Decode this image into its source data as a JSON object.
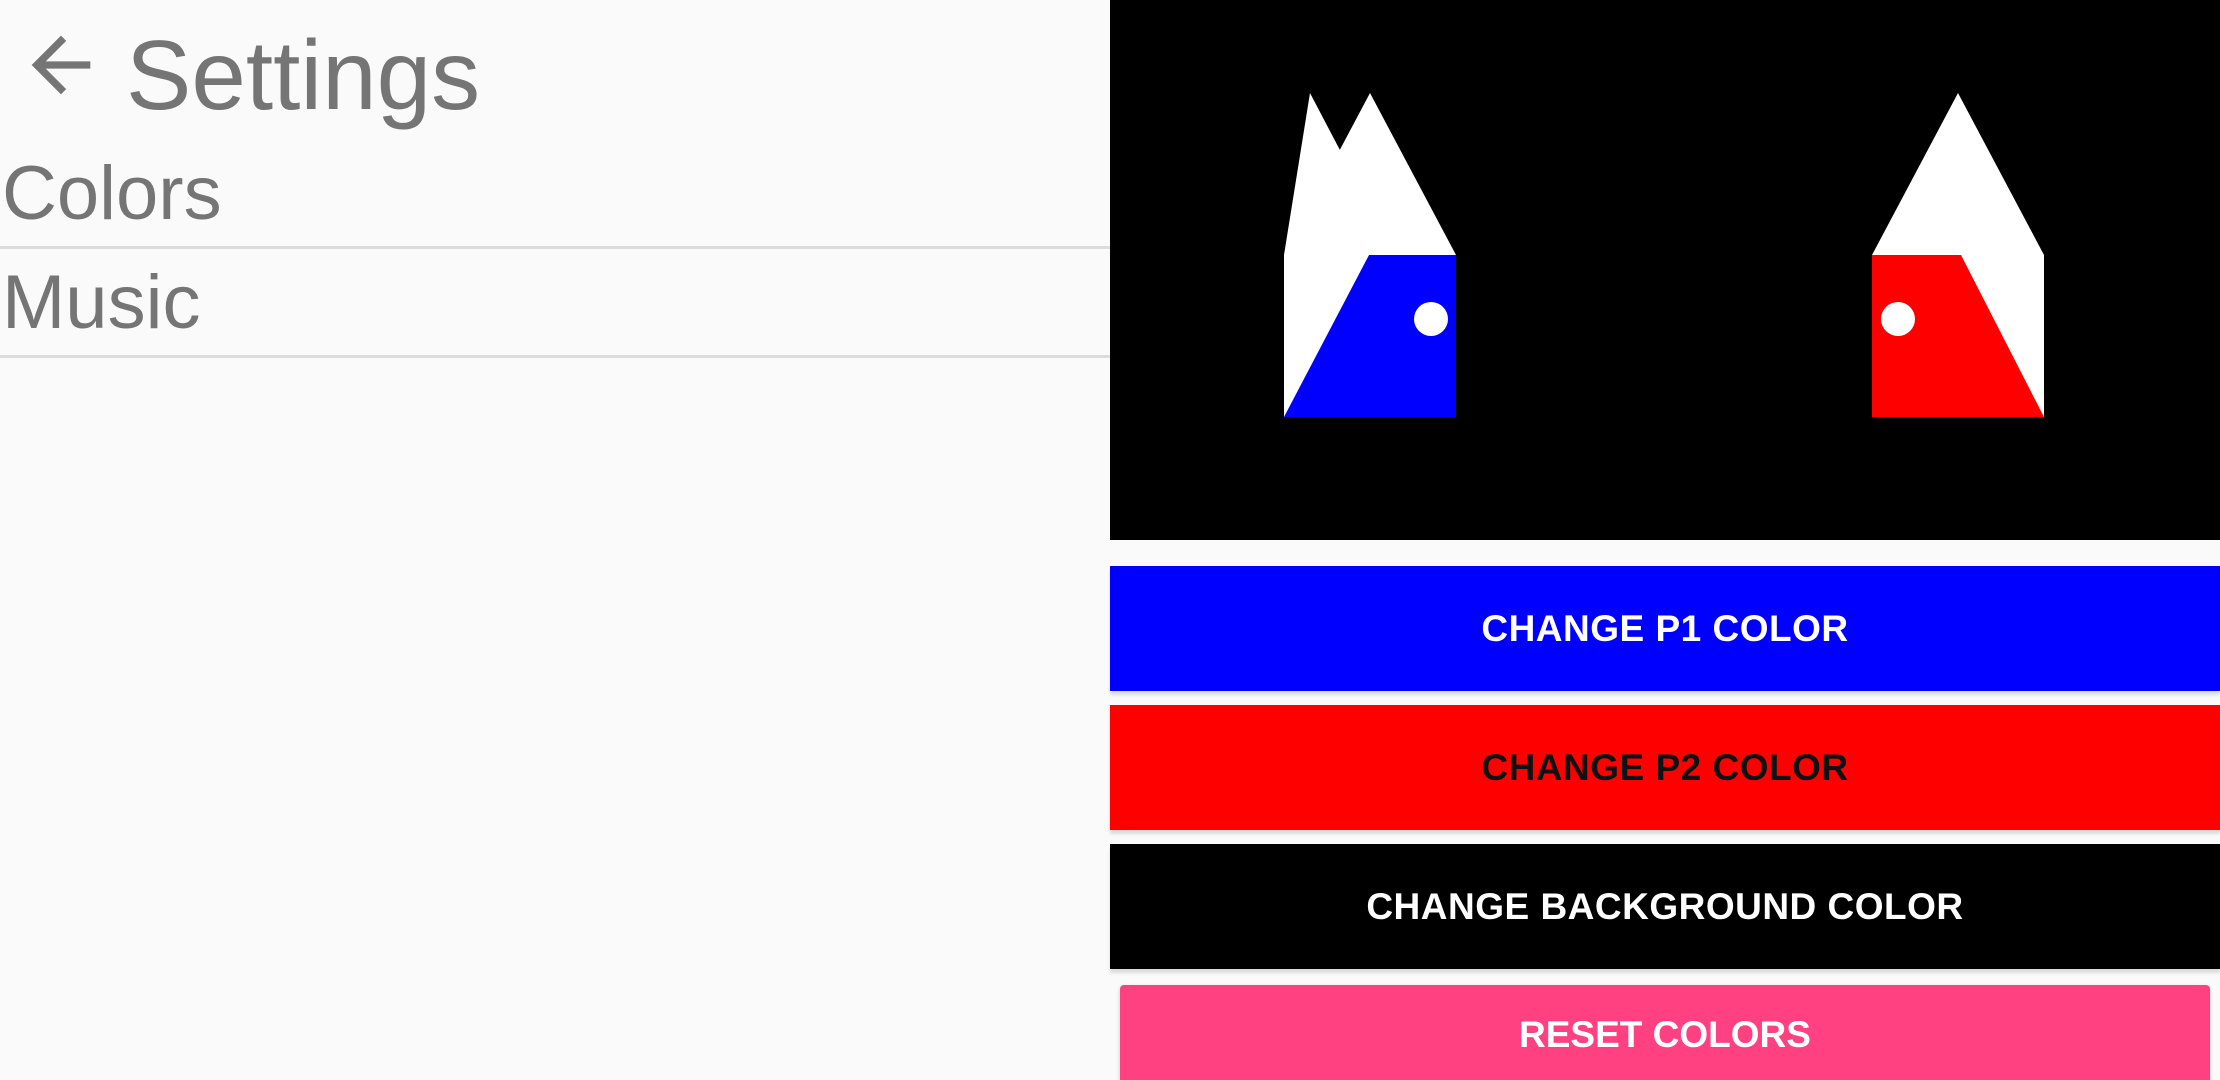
{
  "header": {
    "title": "Settings",
    "back_icon": "arrow-back-icon"
  },
  "settings_list": {
    "items": [
      {
        "label": "Colors"
      },
      {
        "label": "Music"
      }
    ]
  },
  "preview": {
    "background_color": "#000000",
    "house_color": "#ffffff",
    "player1_color": "#0000ff",
    "player2_color": "#ff0000",
    "window_color": "#ffffff"
  },
  "buttons": {
    "change_p1": {
      "label": "CHANGE P1 COLOR",
      "bg": "#0000ff",
      "fg": "#ffffff"
    },
    "change_p2": {
      "label": "CHANGE P2 COLOR",
      "bg": "#ff0000",
      "fg": "#111111"
    },
    "change_bg": {
      "label": "CHANGE BACKGROUND COLOR",
      "bg": "#000000",
      "fg": "#ffffff"
    },
    "reset": {
      "label": "RESET COLORS",
      "bg": "#ff4081",
      "fg": "#ffffff"
    }
  }
}
